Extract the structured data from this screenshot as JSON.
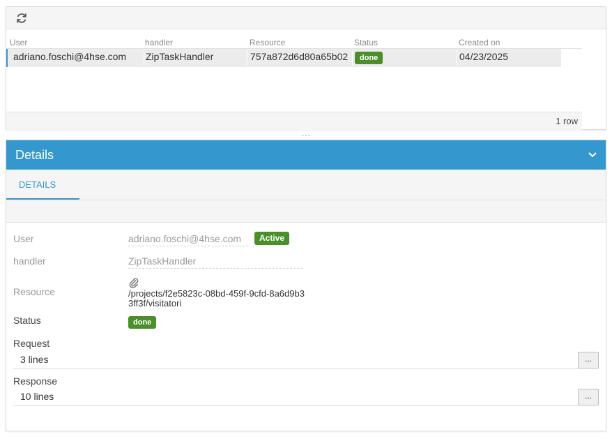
{
  "toolbar": {
    "refresh_icon": "refresh-icon"
  },
  "grid": {
    "columns": [
      "User",
      "handler",
      "Resource",
      "Status",
      "Created on"
    ],
    "rows": [
      {
        "user": "adriano.foschi@4hse.com",
        "handler": "ZipTaskHandler",
        "resource": "757a872d6d80a65b02",
        "status": "done",
        "created_on": "04/23/2025"
      }
    ],
    "footer": "1 row"
  },
  "splitter": "...",
  "details": {
    "title": "Details",
    "tab": "DETAILS",
    "fields": {
      "user_label": "User",
      "user_value": "adriano.foschi@4hse.com",
      "user_badge": "Active",
      "handler_label": "handler",
      "handler_value": "ZipTaskHandler",
      "resource_label": "Resource",
      "resource_value": "/projects/f2e5823c-08bd-459f-9cfd-8a6d9b33ff3f/visitatori",
      "status_label": "Status",
      "status_value": "done",
      "request_label": "Request",
      "request_value": "3 lines",
      "response_label": "Response",
      "response_value": "10 lines",
      "more_button": "..."
    }
  },
  "colors": {
    "accent": "#3498cf",
    "success": "#4a8f2a"
  }
}
